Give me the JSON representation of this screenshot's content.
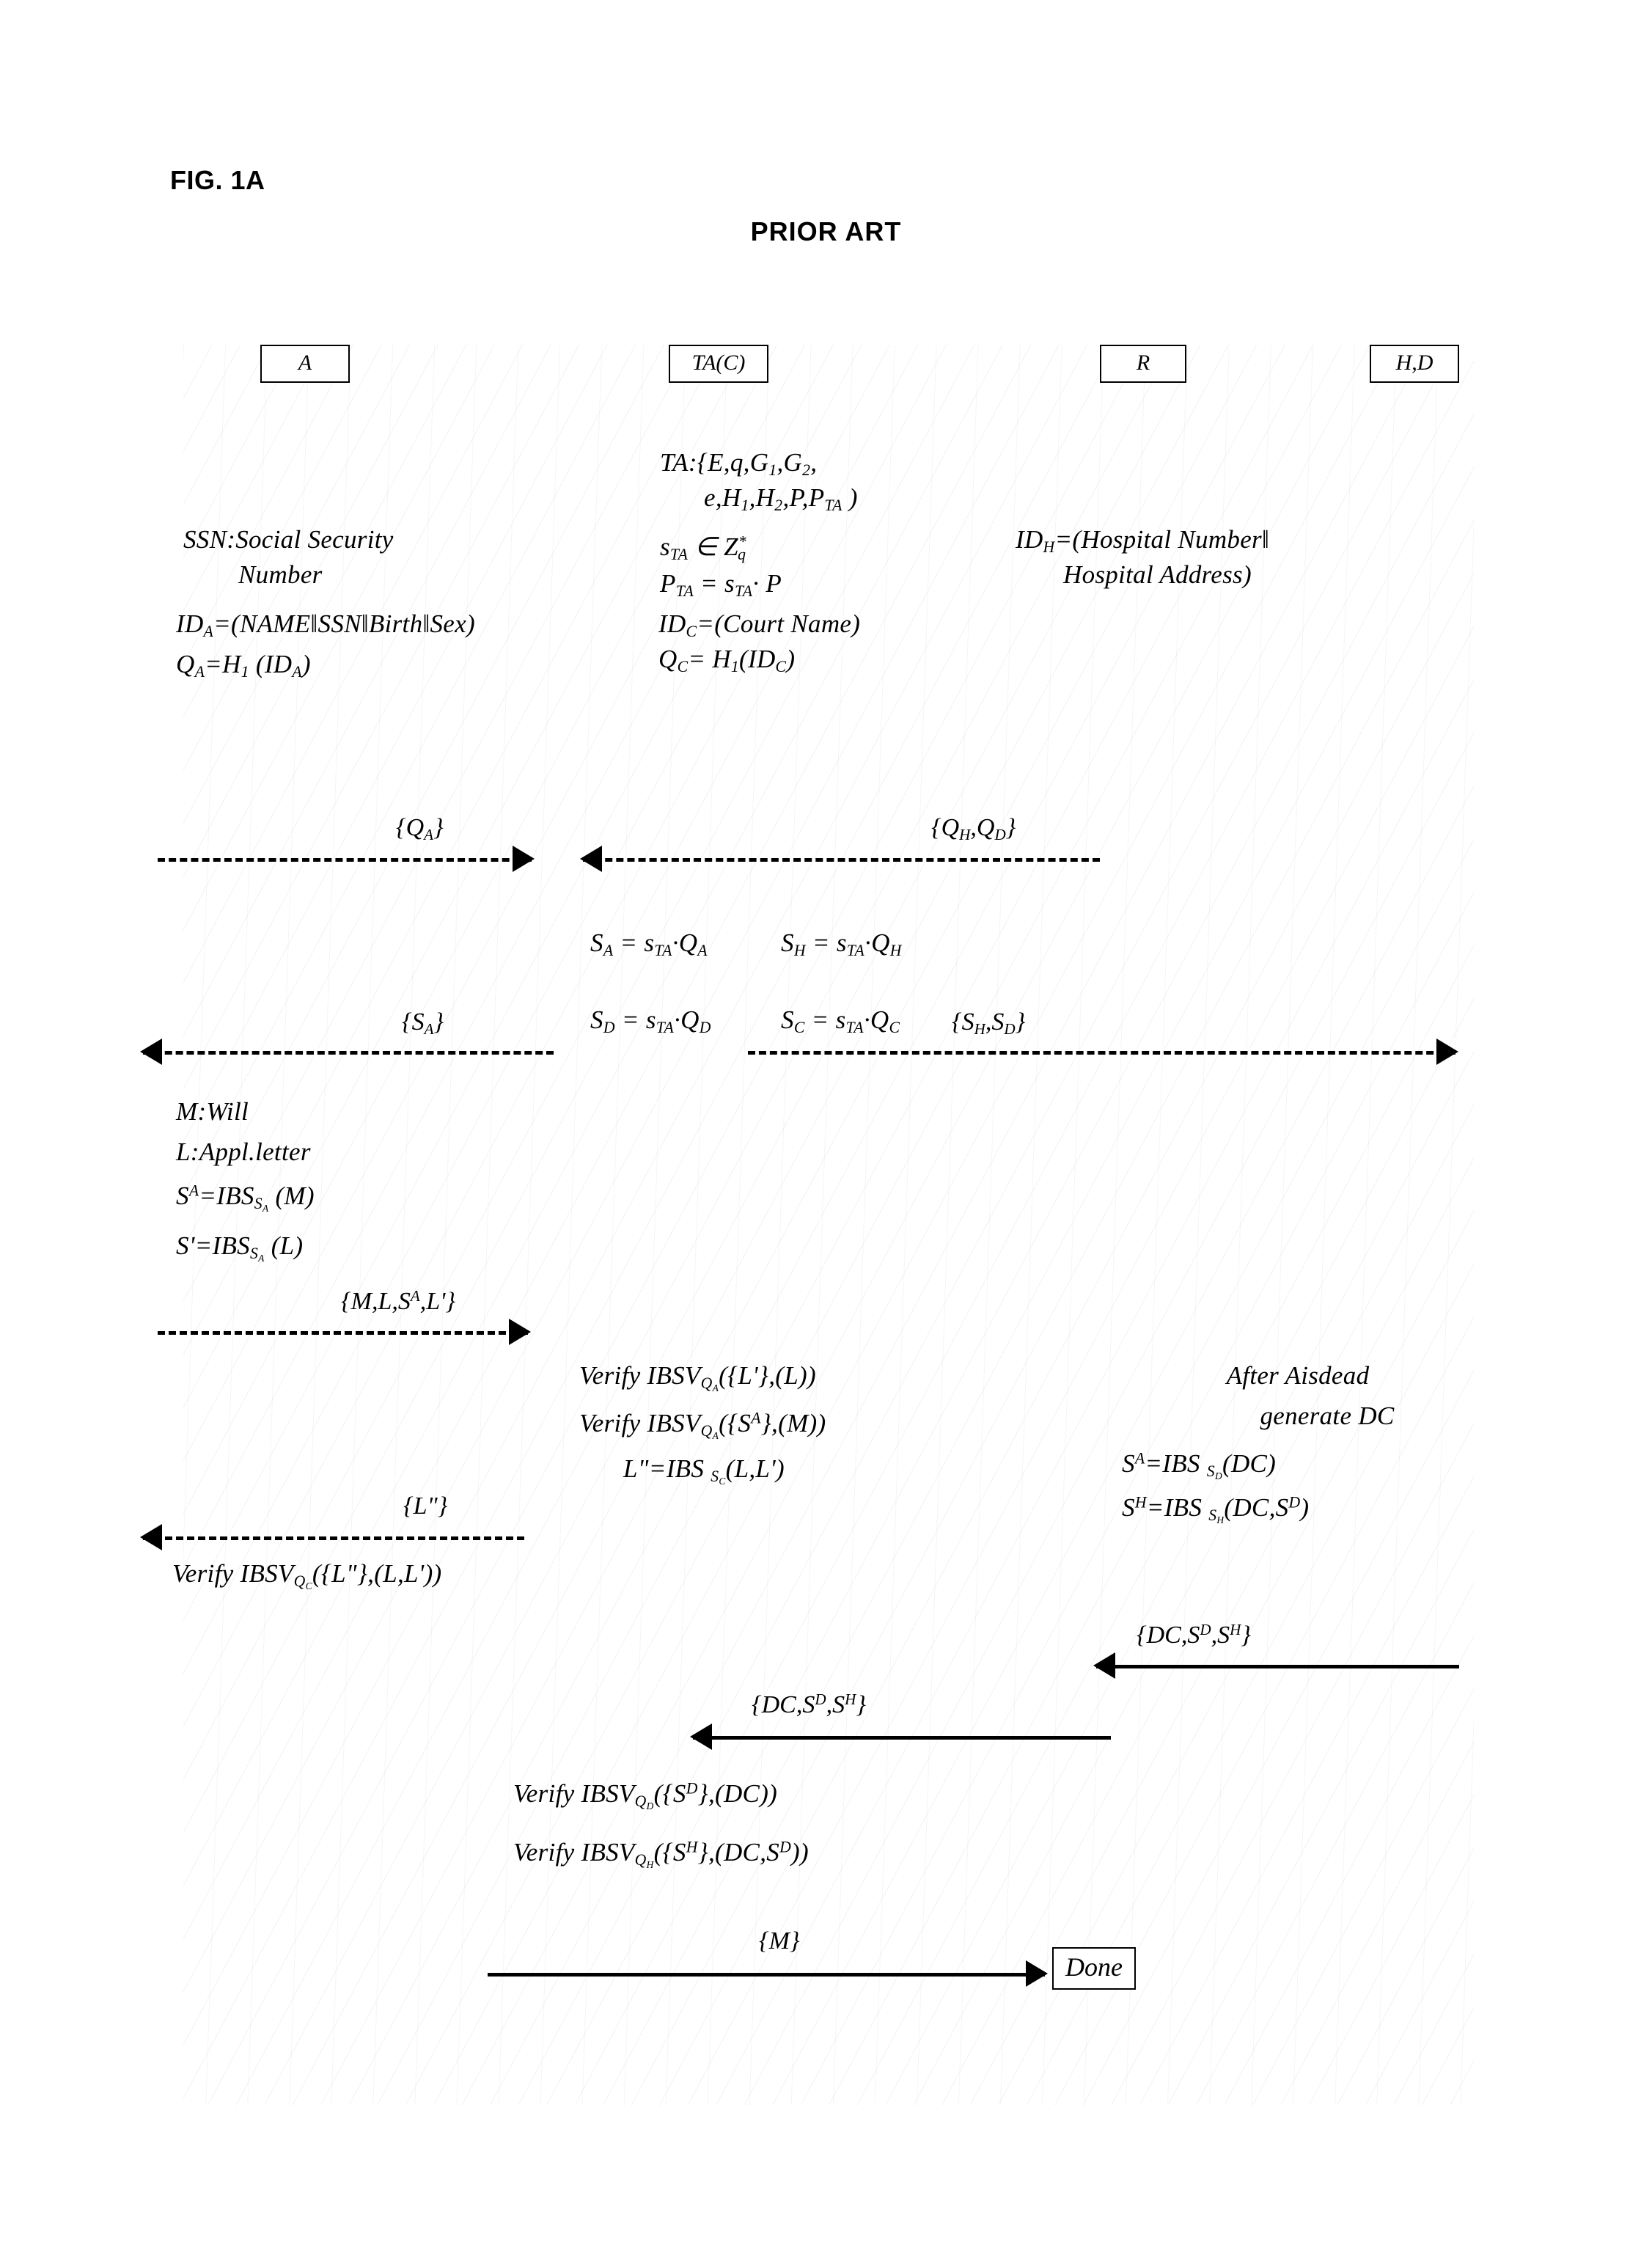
{
  "figure": {
    "label": "FIG. 1A",
    "subtitle": "PRIOR ART"
  },
  "parties": [
    {
      "id": "a",
      "label": "A"
    },
    {
      "id": "ta",
      "label": "TA(C)"
    },
    {
      "id": "r",
      "label": "R"
    },
    {
      "id": "hd",
      "label": "H,D"
    }
  ],
  "ta_setup": {
    "line1": "TA:{E,q,G₁,G₂,",
    "line2": "e,H₁,H₂,P,P_TA )",
    "line3": "s_TA ∈ Z*_q",
    "line4": "P_TA = s_TA· P",
    "line5": "ID_C=(Court Name)",
    "line6": "Q_C= H₁(ID_C)"
  },
  "user_a": {
    "ssn_line1": "SSN:Social Security",
    "ssn_line2": "Number",
    "id_a": "ID_A=(NAME‖SSN‖Birth‖Sex)",
    "q_a": "Q_A=H₁(ID_A)",
    "m": "M:Will",
    "l": "L:Appl.letter",
    "s_a": "S^A=IBS_{S_A}(M)",
    "s_prime": "S'=IBS_{S_A}(L)",
    "verify_l2": "Verify IBSV_{Q_C}({L\"},(L,L'))"
  },
  "hospital": {
    "id_h_line1": "ID_H=(Hospital Number‖",
    "id_h_line2": "Hospital Address)",
    "after_line1": "After Aisdead",
    "after_line2": "generate DC",
    "s_a_dc": "S^A=IBS_{S_D}(DC)",
    "s_h_dc": "S^H=IBS_{S_H}(DC,S^D)"
  },
  "ta_compute": {
    "s_a": "S_A = s_TA·Q_A",
    "s_h": "S_H = s_TA·Q_H",
    "s_d": "S_D = s_TA·Q_D",
    "s_c": "S_C = s_TA·Q_C",
    "verify_l_prime": "Verify IBSV_{Q_A}({L'},(L))",
    "verify_s_a": "Verify IBSV_{Q_A}({S^A},(M))",
    "l_double": "L\"=IBS_{S_C}(L,L')",
    "verify_s_d": "Verify IBSV_{Q_D}({S^D},(DC))",
    "verify_s_h": "Verify IBSV_{Q_H}({S^H},(DC,S^D))"
  },
  "messages": {
    "m1": "{Q_A}",
    "m2": "{Q_H,Q_D}",
    "m3": "{S_A}",
    "m4": "{S_H,S_D}",
    "m5": "{M,L,S^A,L'}",
    "m6": "{L\"}",
    "m7": "{DC,S^D,S^H}",
    "m8": "{DC,S^D,S^H}",
    "m9": "{M}"
  },
  "done": {
    "label": "Done"
  }
}
